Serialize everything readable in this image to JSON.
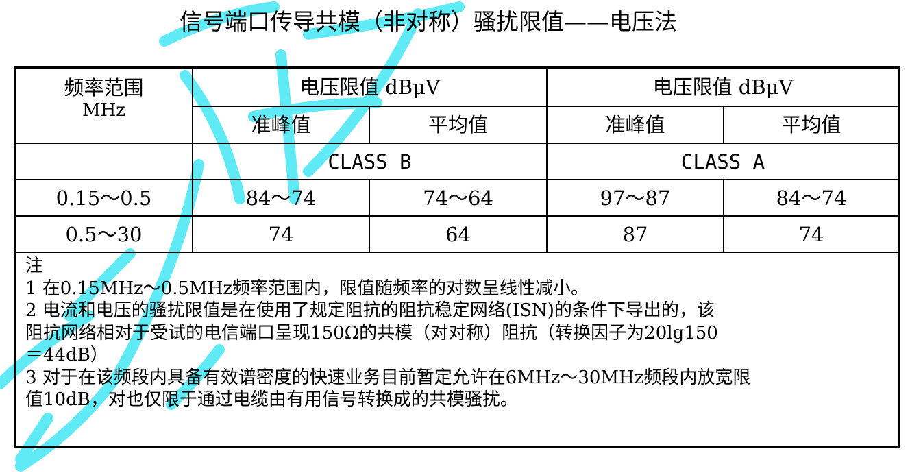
{
  "title": "信号端口传导共模（非对称）骚扰限值——电压法",
  "table": {
    "freq_header_line1": "频率范围",
    "freq_header_line2": "MHz",
    "group_b_header": "电压限值 dBμV",
    "group_a_header": "电压限值 dBμV",
    "sub_headers": [
      "准峰值",
      "平均值",
      "准峰值",
      "平均值"
    ],
    "class_b_label": "CLASS B",
    "class_a_label": "CLASS A",
    "rows": [
      {
        "freq": "0.15～0.5",
        "b_qp": "84～74",
        "b_avg": "74～64",
        "a_qp": "97～87",
        "a_avg": "84～74"
      },
      {
        "freq": "0.5～30",
        "b_qp": "74",
        "b_avg": "64",
        "a_qp": "87",
        "a_avg": "74"
      }
    ]
  },
  "notes": {
    "heading": "注",
    "lines": [
      "1 在0.15MHz～0.5MHz频率范围内，限值随频率的对数呈线性减小。",
      "2 电流和电压的骚扰限值是在使用了规定阻抗的阻抗稳定网络(ISN)的条件下导出的，该",
      "阻抗网络相对于受试的电信端口呈现150Ω的共模（对对称）阻抗（转换因子为20lg150",
      "＝44dB）",
      "3 对于在该频段内具备有效谱密度的快速业务目前暂定允许在6MHz～30MHz频段内放宽限",
      "值10dB，对也仅限于通过电缆由有用信号转换成的共模骚扰。"
    ]
  },
  "watermark_color": "#4fe8f4"
}
